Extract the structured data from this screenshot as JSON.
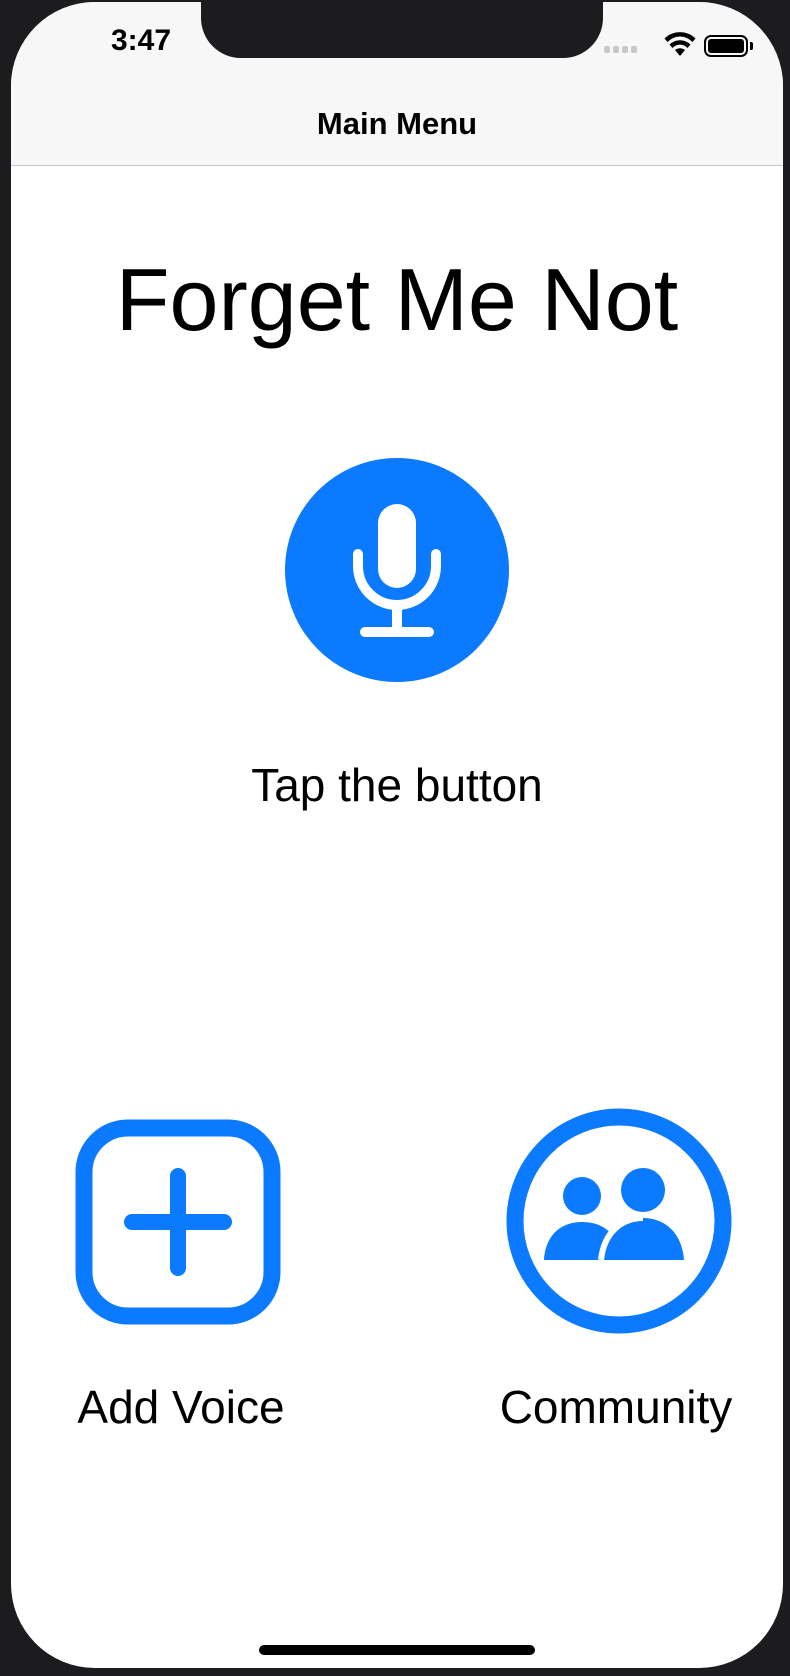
{
  "status_bar": {
    "time": "3:47",
    "icons": [
      "cellular-signal-icon",
      "wifi-icon",
      "battery-icon"
    ]
  },
  "nav": {
    "title": "Main Menu"
  },
  "main": {
    "app_title": "Forget Me Not",
    "record_button_icon": "microphone-icon",
    "record_hint": "Tap the button"
  },
  "actions": {
    "add_voice": {
      "label": "Add Voice",
      "icon": "plus-square-icon"
    },
    "community": {
      "label": "Community",
      "icon": "people-circle-icon"
    }
  },
  "colors": {
    "accent": "#0b7aff",
    "nav_background": "#f7f7f7",
    "background": "#ffffff",
    "text": "#000000"
  }
}
